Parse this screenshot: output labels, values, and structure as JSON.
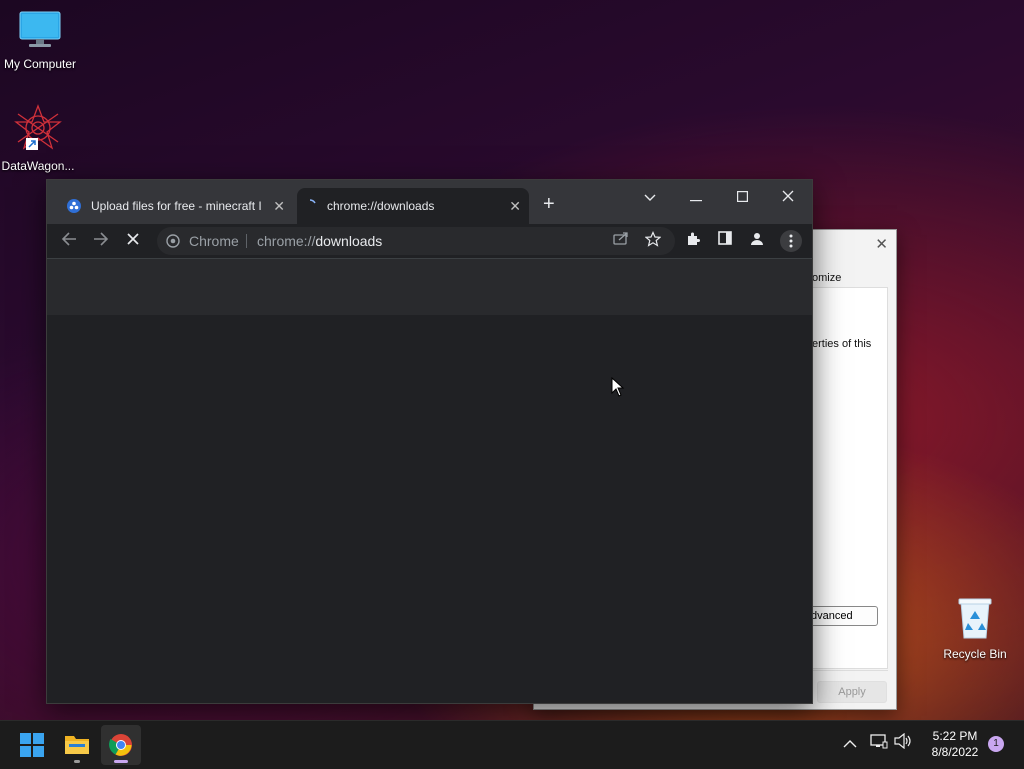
{
  "desktop": {
    "icons": [
      {
        "label": "My Computer",
        "icon": "monitor-icon"
      },
      {
        "label": "DataWagon...",
        "icon": "datawagon-logo-icon"
      },
      {
        "label": "Recycle Bin",
        "icon": "recycle-bin-icon"
      }
    ]
  },
  "dialog": {
    "fragment_customize": "omize",
    "fragment_properties": "erties of this",
    "advanced_label": "dvanced",
    "apply_label": "Apply",
    "close_icon": "close-icon"
  },
  "browser": {
    "tabs": [
      {
        "title": "Upload files for free - minecraft I",
        "icon": "upload-site-favicon",
        "active": false
      },
      {
        "title": "chrome://downloads",
        "icon": "loading-spinner-icon",
        "active": true
      }
    ],
    "new_tab_label": "+",
    "omnibox": {
      "chip": "Chrome",
      "url_scheme": "chrome://",
      "url_host": "downloads"
    },
    "toolbar_icons": [
      "back-icon",
      "forward-icon",
      "stop-icon",
      "share-icon",
      "star-icon",
      "extensions-icon",
      "side-panel-icon",
      "profile-icon",
      "menu-icon"
    ]
  },
  "taskbar": {
    "apps": [
      {
        "name": "start",
        "icon": "windows-start-icon"
      },
      {
        "name": "file-explorer",
        "icon": "folder-icon"
      },
      {
        "name": "chrome",
        "icon": "chrome-icon"
      }
    ],
    "clock": {
      "time": "5:22 PM",
      "date": "8/8/2022"
    },
    "notification_count": "1",
    "tray_icons": [
      "chevron-up-icon",
      "network-icon",
      "volume-icon"
    ]
  },
  "colors": {
    "chrome_bg": "#202124",
    "tabstrip": "#35363a",
    "taskbar": "#1c1c1c"
  }
}
